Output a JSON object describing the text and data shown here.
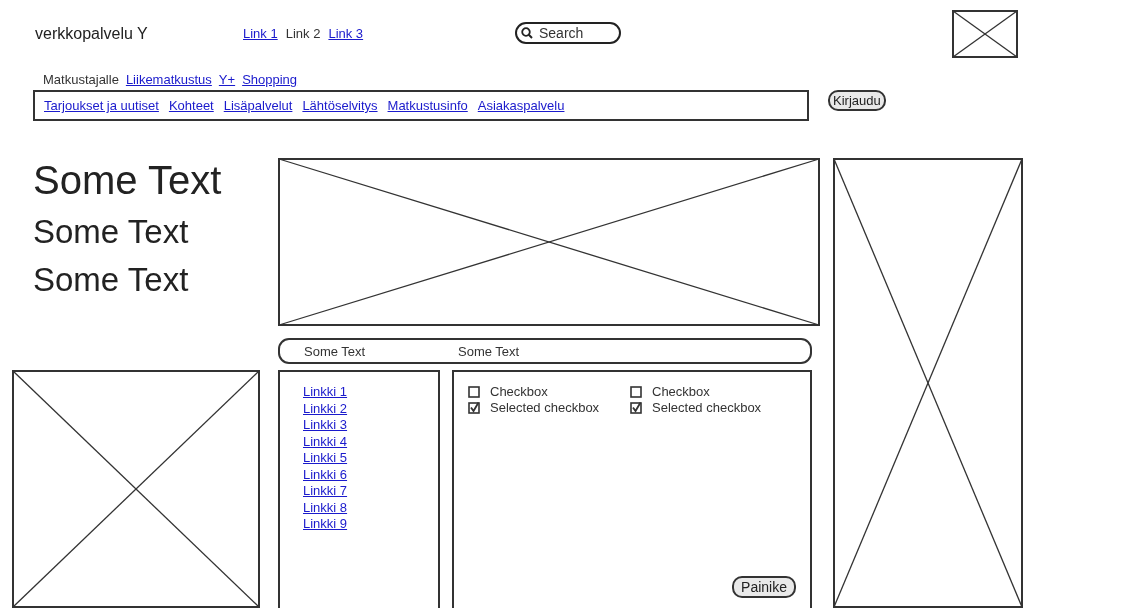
{
  "header": {
    "site_name": "verkkopalvelu Y",
    "links": [
      {
        "label": "Link 1",
        "selected": false
      },
      {
        "label": "Link 2",
        "selected": true
      },
      {
        "label": "Link 3",
        "selected": false
      }
    ],
    "search": {
      "placeholder": "Search"
    }
  },
  "nav": {
    "tabs": [
      {
        "label": "Matkustajalle",
        "selected": true
      },
      {
        "label": "Liikematkustus",
        "selected": false
      },
      {
        "label": "Y+",
        "selected": false
      },
      {
        "label": "Shopping",
        "selected": false
      }
    ],
    "menu": [
      "Tarjoukset ja uutiset",
      "Kohteet",
      "Lisäpalvelut",
      "Lähtöselvitys",
      "Matkustusinfo",
      "Asiakaspalvelu"
    ],
    "login_button": "Kirjaudu"
  },
  "headings": [
    {
      "text": "Some Text",
      "kind": "large"
    },
    {
      "text": "Some Text",
      "kind": "medium"
    },
    {
      "text": "Some Text",
      "kind": "medium"
    }
  ],
  "info_bar": [
    "Some Text",
    "Some Text"
  ],
  "sidebar_links": [
    "Linkki 1",
    "Linkki 2",
    "Linkki 3",
    "Linkki 4",
    "Linkki 5",
    "Linkki 6",
    "Linkki 7",
    "Linkki 8",
    "Linkki 9"
  ],
  "checkboxes": [
    {
      "label": "Checkbox",
      "checked": false
    },
    {
      "label": "Checkbox",
      "checked": false
    },
    {
      "label": "Selected checkbox",
      "checked": true
    },
    {
      "label": "Selected checkbox",
      "checked": true
    }
  ],
  "action_button": "Painike"
}
